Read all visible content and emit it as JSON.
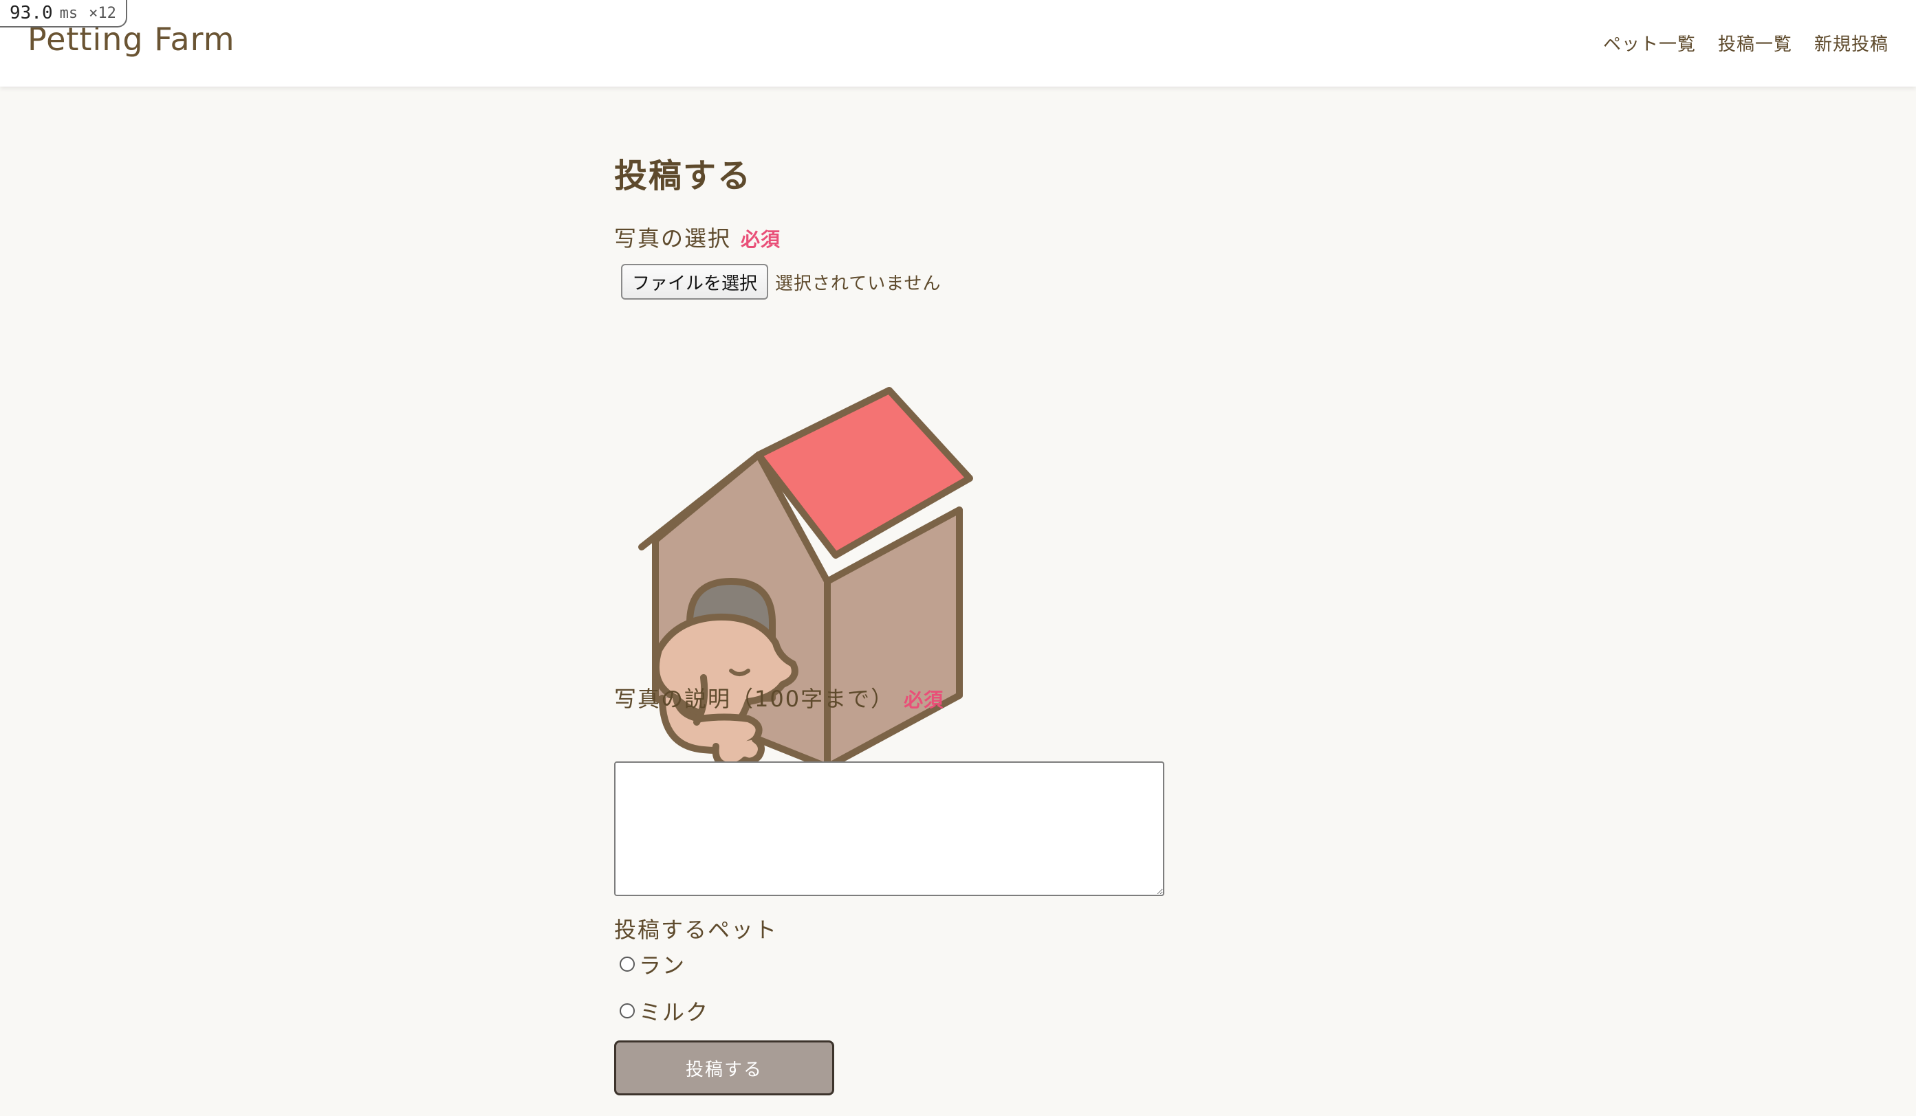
{
  "perf_badge": {
    "value": "93.0",
    "unit": "ms",
    "multiplier": "×12"
  },
  "header": {
    "logo": "Petting Farm",
    "nav": [
      {
        "label": "ペット一覧"
      },
      {
        "label": "投稿一覧"
      },
      {
        "label": "新規投稿"
      }
    ]
  },
  "form": {
    "title": "投稿する",
    "photo": {
      "label": "写真の選択",
      "required": "必須",
      "button_label": "ファイルを選択",
      "status": "選択されていません"
    },
    "preview_image": "doghouse-with-sleeping-dog",
    "description": {
      "label": "写真の説明（100字まで）",
      "required": "必須",
      "value": ""
    },
    "pet": {
      "label": "投稿するペット",
      "options": [
        {
          "label": "ラン",
          "checked": false
        },
        {
          "label": "ミルク",
          "checked": false
        }
      ]
    },
    "submit_label": "投稿する"
  },
  "colors": {
    "background": "#f9f8f5",
    "text": "#5e4a2c",
    "required": "#e94f78",
    "button": "#a89d96",
    "roof": "#f47373",
    "house": "#bfa190",
    "outline": "#7b6347",
    "dog": "#e5bda6"
  }
}
